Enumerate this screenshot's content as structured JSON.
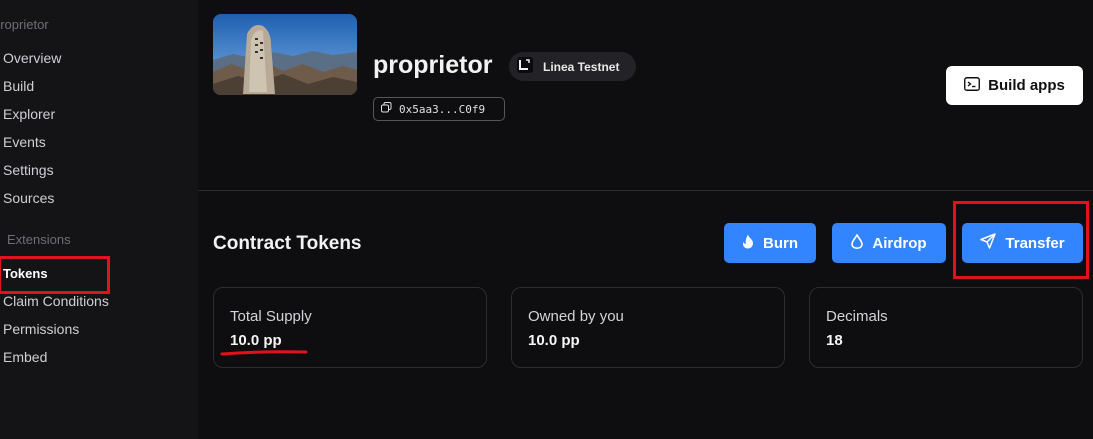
{
  "sidebar": {
    "contract_label": "proprietor",
    "items": [
      {
        "label": "Overview"
      },
      {
        "label": "Build"
      },
      {
        "label": "Explorer"
      },
      {
        "label": "Events"
      },
      {
        "label": "Settings"
      },
      {
        "label": "Sources"
      }
    ],
    "extensions_heading": "Extensions",
    "ext_items": [
      {
        "label": "Tokens"
      },
      {
        "label": "Claim Conditions"
      },
      {
        "label": "Permissions"
      },
      {
        "label": "Embed"
      }
    ]
  },
  "header": {
    "name": "proprietor",
    "chain": "Linea Testnet",
    "address": "0x5aa3...C0f9",
    "build_label": "Build apps"
  },
  "tokens": {
    "title": "Contract Tokens",
    "burn_label": "Burn",
    "airdrop_label": "Airdrop",
    "transfer_label": "Transfer",
    "stats": [
      {
        "label": "Total Supply",
        "value": "10.0 pp"
      },
      {
        "label": "Owned by you",
        "value": "10.0 pp"
      },
      {
        "label": "Decimals",
        "value": "18"
      }
    ]
  },
  "colors": {
    "accent": "#3385ff",
    "highlight": "#e0121b"
  }
}
